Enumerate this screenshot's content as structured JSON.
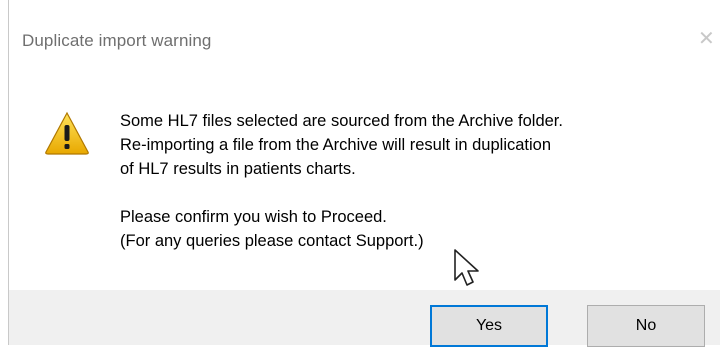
{
  "window": {
    "title": "Duplicate import warning",
    "close_glyph": "✕"
  },
  "icon": "warning-icon",
  "message": {
    "lines": [
      "Some HL7 files selected are sourced from the Archive folder.",
      "Re-importing a file from the Archive will result in duplication",
      "of HL7 results in patients charts."
    ],
    "confirm_lines": [
      "Please confirm you wish to Proceed.",
      "(For any queries please contact Support.)"
    ]
  },
  "buttons": {
    "yes_label": "Yes",
    "no_label": "No"
  },
  "colors": {
    "focus_border": "#0078d7",
    "warning_fill": "#f5c400"
  }
}
